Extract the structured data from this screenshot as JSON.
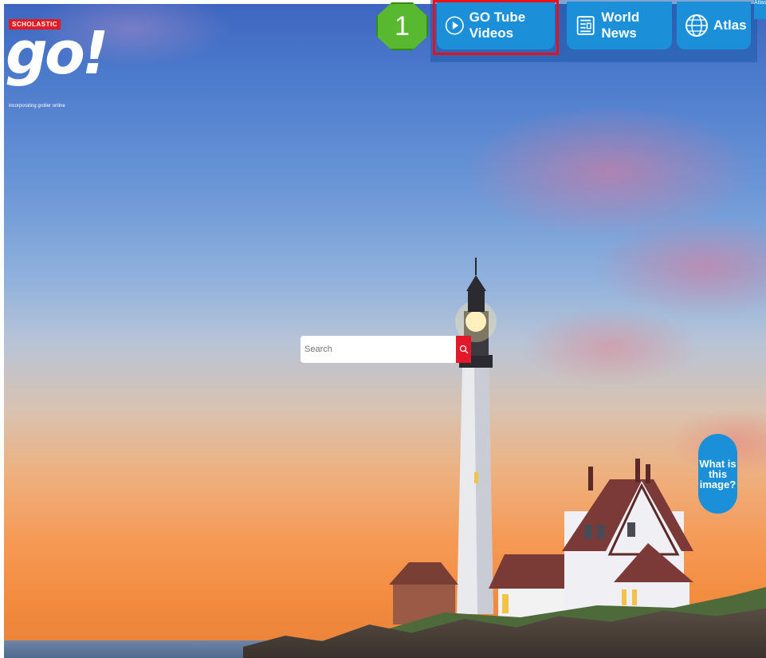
{
  "brand": {
    "publisher": "SCHOLASTIC",
    "product": "go!",
    "tagline": "incorporating grolier online"
  },
  "nav": {
    "items": [
      {
        "label": "GO Tube Videos",
        "icon": "play-circle-icon"
      },
      {
        "label": "World News",
        "icon": "newspaper-icon"
      },
      {
        "label": "Atlas",
        "icon": "globe-icon"
      }
    ],
    "corner_label": "Atlas",
    "highlighted_item": "GO Tube Videos",
    "step_number": "1"
  },
  "search": {
    "placeholder": "Search",
    "icon": "search-icon"
  },
  "image_info": {
    "label": "What is this image?"
  },
  "colors": {
    "nav_blue": "#1b8fd8",
    "highlight_red": "#e8101a",
    "step_green": "#58b830",
    "search_red": "#e4182b"
  }
}
